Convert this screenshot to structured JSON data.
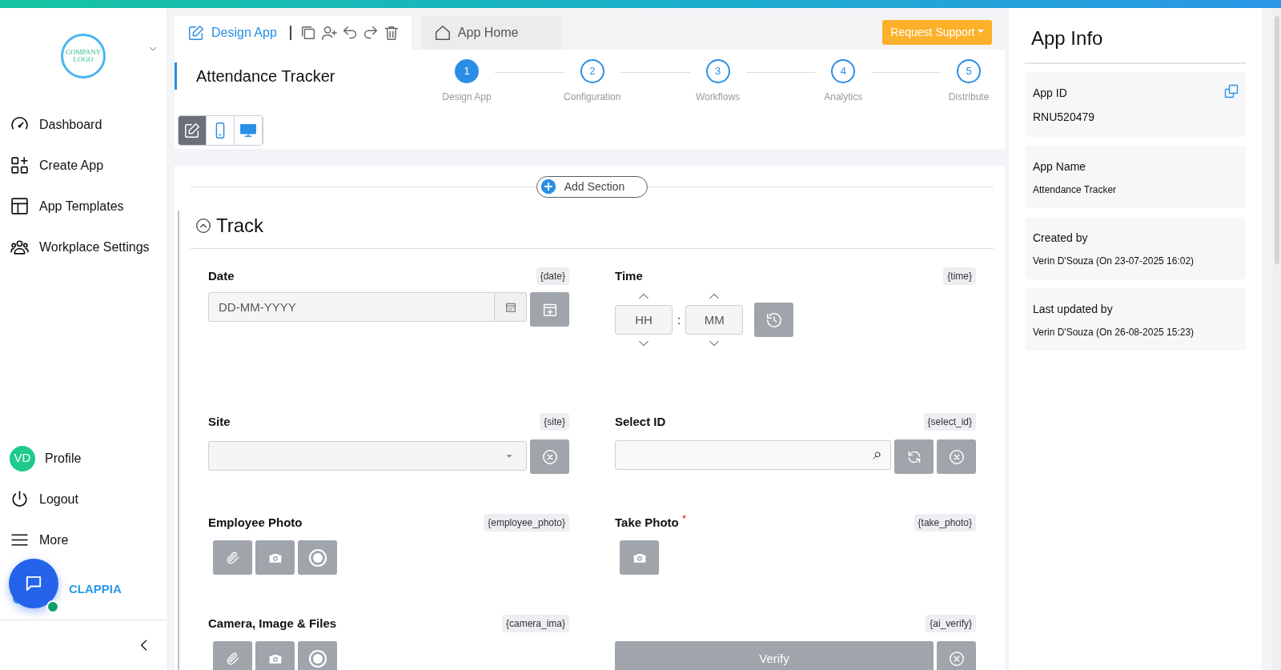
{
  "sidebar": {
    "logo": "COMPANY LOGO",
    "items": [
      {
        "label": "Dashboard"
      },
      {
        "label": "Create App"
      },
      {
        "label": "App Templates"
      },
      {
        "label": "Workplace Settings"
      }
    ],
    "bottom_items": [
      {
        "label": "Profile",
        "initials": "VD"
      },
      {
        "label": "Logout"
      },
      {
        "label": "More"
      }
    ],
    "brand": "CLAPPIA",
    "chat_online": true
  },
  "top_tabs": [
    {
      "label": "Design App",
      "kind": "design",
      "selected": true
    },
    {
      "label": "App Home",
      "kind": "home",
      "selected": false
    }
  ],
  "request_support": "Request Support",
  "app_title": "Attendance Tracker",
  "steps": [
    {
      "number": "1",
      "label": "Design App",
      "selected": true
    },
    {
      "number": "2",
      "label": "Configuration",
      "selected": false
    },
    {
      "number": "3",
      "label": "Workflows",
      "selected": false
    },
    {
      "number": "4",
      "label": "Analytics",
      "selected": false
    },
    {
      "number": "5",
      "label": "Distribute",
      "selected": false
    }
  ],
  "view_modes": [
    {
      "kind": "edit",
      "selected": true
    },
    {
      "kind": "mobile",
      "selected": false
    },
    {
      "kind": "desktop",
      "selected": false
    }
  ],
  "add_section": "Add Section",
  "section": {
    "title": "Track",
    "expanded": true,
    "fields": [
      {
        "kind": "date",
        "label": "Date",
        "variable": "{date}",
        "placeholder": "DD-MM-YYYY",
        "required": false
      },
      {
        "kind": "time",
        "label": "Time",
        "variable": "{time}",
        "hour_placeholder": "HH",
        "minute_placeholder": "MM",
        "separator": ":",
        "required": false
      },
      {
        "kind": "dropdown",
        "label": "Site",
        "variable": "{site}",
        "required": false
      },
      {
        "kind": "lookup",
        "label": "Select ID",
        "variable": "{select_id}",
        "required": false
      },
      {
        "kind": "files",
        "label": "Employee Photo",
        "variable": "{employee_photo}",
        "required": false
      },
      {
        "kind": "camera",
        "label": "Take Photo",
        "variable": "{take_photo}",
        "required": true
      },
      {
        "kind": "files",
        "label": "Camera, Image & Files",
        "variable": "{camera_ima}",
        "required": false
      },
      {
        "kind": "verify",
        "variable": "{ai_verify}",
        "button": "Verify",
        "required": false
      }
    ]
  },
  "app_info": {
    "title": "App Info",
    "cards": [
      {
        "label": "App ID",
        "value": "RNU520479",
        "copyable": true
      },
      {
        "label": "App Name",
        "value": "Attendance Tracker",
        "copyable": false
      },
      {
        "label": "Created by",
        "value": "Verin D'Souza (On 23-07-2025 16:02)",
        "copyable": false
      },
      {
        "label": "Last updated by",
        "value": "Verin D'Souza (On 26-08-2025 15:23)",
        "copyable": false
      }
    ]
  }
}
